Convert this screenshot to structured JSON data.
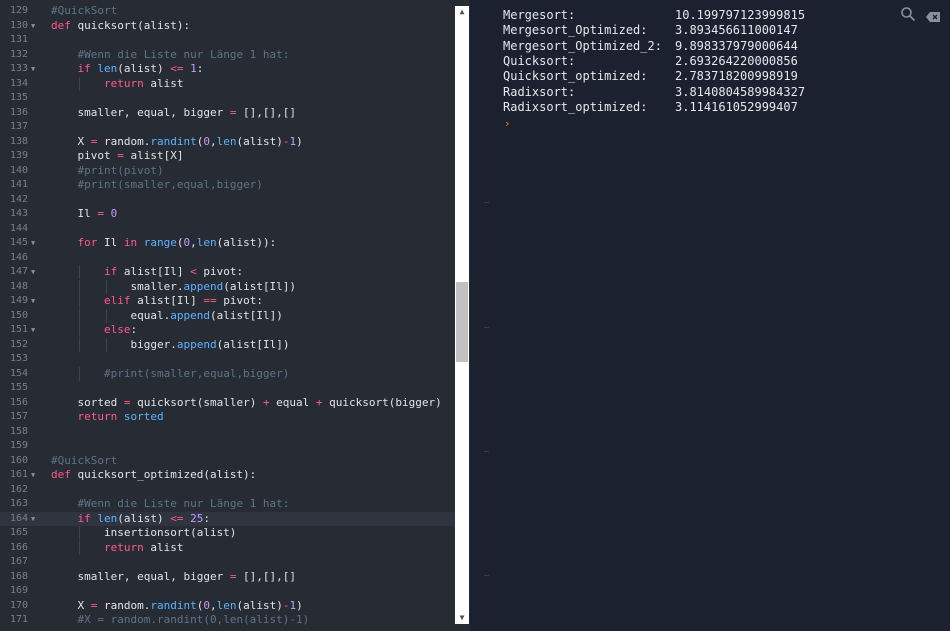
{
  "editor": {
    "active_line": "164",
    "lines": [
      {
        "n": "129",
        "fold": false,
        "html": "<span class=\"cm\">#QuickSort</span>"
      },
      {
        "n": "130",
        "fold": true,
        "html": "<span class=\"kw\">def</span> quicksort(alist):"
      },
      {
        "n": "131",
        "fold": false,
        "html": ""
      },
      {
        "n": "132",
        "fold": false,
        "html": "    <span class=\"cm\">#Wenn die Liste nur Länge 1 hat:</span>"
      },
      {
        "n": "133",
        "fold": true,
        "html": "    <span class=\"kw\">if</span> <span class=\"fn\">len</span>(alist) <span class=\"op\">&lt;=</span> <span class=\"num\">1</span>:"
      },
      {
        "n": "134",
        "fold": false,
        "html": "        <span class=\"kw\">return</span> alist"
      },
      {
        "n": "135",
        "fold": false,
        "html": ""
      },
      {
        "n": "136",
        "fold": false,
        "html": "    smaller, equal, bigger <span class=\"op\">=</span> [],[],[]"
      },
      {
        "n": "137",
        "fold": false,
        "html": ""
      },
      {
        "n": "138",
        "fold": false,
        "html": "    X <span class=\"op\">=</span> random.<span class=\"fn\">randint</span>(<span class=\"num\">0</span>,<span class=\"fn\">len</span>(alist)<span class=\"op\">-</span><span class=\"num\">1</span>)"
      },
      {
        "n": "139",
        "fold": false,
        "html": "    pivot <span class=\"op\">=</span> alist[X]"
      },
      {
        "n": "140",
        "fold": false,
        "html": "    <span class=\"cm\">#print(pivot)</span>"
      },
      {
        "n": "141",
        "fold": false,
        "html": "    <span class=\"cm\">#print(smaller,equal,bigger)</span>"
      },
      {
        "n": "142",
        "fold": false,
        "html": ""
      },
      {
        "n": "143",
        "fold": false,
        "html": "    Il <span class=\"op\">=</span> <span class=\"num\">0</span>"
      },
      {
        "n": "144",
        "fold": false,
        "html": ""
      },
      {
        "n": "145",
        "fold": true,
        "html": "    <span class=\"kw\">for</span> Il <span class=\"kw\">in</span> <span class=\"fn\">range</span>(<span class=\"num\">0</span>,<span class=\"fn\">len</span>(alist)):"
      },
      {
        "n": "146",
        "fold": false,
        "html": ""
      },
      {
        "n": "147",
        "fold": true,
        "html": "        <span class=\"kw\">if</span> alist[Il] <span class=\"op\">&lt;</span> pivot:"
      },
      {
        "n": "148",
        "fold": false,
        "html": "            smaller.<span class=\"fn\">append</span>(alist[Il])"
      },
      {
        "n": "149",
        "fold": true,
        "html": "        <span class=\"kw\">elif</span> alist[Il] <span class=\"op\">==</span> pivot:"
      },
      {
        "n": "150",
        "fold": false,
        "html": "            equal.<span class=\"fn\">append</span>(alist[Il])"
      },
      {
        "n": "151",
        "fold": true,
        "html": "        <span class=\"kw\">else</span>:"
      },
      {
        "n": "152",
        "fold": false,
        "html": "            bigger.<span class=\"fn\">append</span>(alist[Il])"
      },
      {
        "n": "153",
        "fold": false,
        "html": ""
      },
      {
        "n": "154",
        "fold": false,
        "html": "        <span class=\"cm\">#print(smaller,equal,bigger)</span>"
      },
      {
        "n": "155",
        "fold": false,
        "html": ""
      },
      {
        "n": "156",
        "fold": false,
        "html": "    sorted <span class=\"op\">=</span> quicksort(smaller) <span class=\"op\">+</span> equal <span class=\"op\">+</span> quicksort(bigger)"
      },
      {
        "n": "157",
        "fold": false,
        "html": "    <span class=\"kw\">return</span> <span class=\"fn\">sorted</span>"
      },
      {
        "n": "158",
        "fold": false,
        "html": ""
      },
      {
        "n": "159",
        "fold": false,
        "html": ""
      },
      {
        "n": "160",
        "fold": false,
        "html": "<span class=\"cm\">#QuickSort</span>"
      },
      {
        "n": "161",
        "fold": true,
        "html": "<span class=\"kw\">def</span> quicksort_optimized(alist):"
      },
      {
        "n": "162",
        "fold": false,
        "html": ""
      },
      {
        "n": "163",
        "fold": false,
        "html": "    <span class=\"cm\">#Wenn die Liste nur Länge 1 hat:</span>"
      },
      {
        "n": "164",
        "fold": true,
        "html": "    <span class=\"kw\">if</span> <span class=\"fn\">len</span>(alist) <span class=\"op\">&lt;=</span> <span class=\"num\">25</span>:"
      },
      {
        "n": "165",
        "fold": false,
        "html": "        insertionsort(alist)"
      },
      {
        "n": "166",
        "fold": false,
        "html": "        <span class=\"kw\">return</span> alist"
      },
      {
        "n": "167",
        "fold": false,
        "html": ""
      },
      {
        "n": "168",
        "fold": false,
        "html": "    smaller, equal, bigger <span class=\"op\">=</span> [],[],[]"
      },
      {
        "n": "169",
        "fold": false,
        "html": ""
      },
      {
        "n": "170",
        "fold": false,
        "html": "    X <span class=\"op\">=</span> random.<span class=\"fn\">randint</span>(<span class=\"num\">0</span>,<span class=\"fn\">len</span>(alist)<span class=\"op\">-</span><span class=\"num\">1</span>)"
      },
      {
        "n": "171",
        "fold": false,
        "html": "    <span class=\"cm\">#X = random.randint(0,len(alist)-1)</span>"
      }
    ]
  },
  "console": {
    "results": [
      {
        "name": "Mergesort:",
        "value": "10.199797123999815"
      },
      {
        "name": "Mergesort_Optimized:",
        "value": "3.893456611000147"
      },
      {
        "name": "Mergesort_Optimized_2:",
        "value": "9.898337979000644"
      },
      {
        "name": "Quicksort:",
        "value": "2.693264220000856"
      },
      {
        "name": "Quicksort_optimized:",
        "value": "2.783718200998919"
      },
      {
        "name": "Radixsort:",
        "value": "3.8140804589984327"
      },
      {
        "name": "Radixsort_optimized:",
        "value": "3.114161052999407"
      }
    ],
    "prompt_symbol": "›"
  },
  "icons": {
    "search": "search-icon",
    "clear": "clear-console-icon",
    "scroll_up": "chevron-up-icon",
    "scroll_down": "chevron-down-icon"
  },
  "colors": {
    "editor_bg": "#272b34",
    "console_bg": "#1c2130",
    "keyword": "#ff5a8a",
    "builtin": "#5fb3ff",
    "number": "#c39bff",
    "comment": "#5f7386",
    "prompt": "#ff7a2a"
  }
}
